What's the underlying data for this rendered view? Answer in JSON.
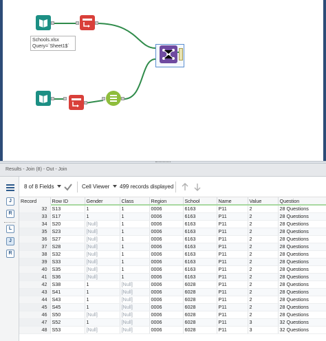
{
  "annotation": {
    "line1": "Schools.xlsx",
    "line2": "Query=`Sheet1$`"
  },
  "results": {
    "title": "Results - Join (8) - Out - Join",
    "fields_label": "8 of 8 Fields",
    "viewer_label": "Cell Viewer",
    "records_label": "499 records displayed"
  },
  "rail": [
    "L",
    "J",
    "R"
  ],
  "rail_top": [
    "J",
    "R"
  ],
  "columns": [
    "Record",
    "Row ID",
    "Gender",
    "Class",
    "Region",
    "School",
    "Name",
    "Value",
    "Question"
  ],
  "rows": [
    [
      "32",
      "S13",
      "1",
      "1",
      "0006",
      "6163",
      "P11",
      "2",
      "28 Questions"
    ],
    [
      "33",
      "S17",
      "1",
      "1",
      "0006",
      "6163",
      "P11",
      "2",
      "28 Questions"
    ],
    [
      "34",
      "S20",
      "[Null]",
      "1",
      "0006",
      "6163",
      "P11",
      "2",
      "28 Questions"
    ],
    [
      "35",
      "S23",
      "[Null]",
      "1",
      "0006",
      "6163",
      "P11",
      "2",
      "28 Questions"
    ],
    [
      "36",
      "S27",
      "[Null]",
      "1",
      "0006",
      "6163",
      "P11",
      "2",
      "28 Questions"
    ],
    [
      "37",
      "S28",
      "[Null]",
      "1",
      "0006",
      "6163",
      "P11",
      "2",
      "28 Questions"
    ],
    [
      "38",
      "S32",
      "[Null]",
      "1",
      "0006",
      "6163",
      "P11",
      "2",
      "28 Questions"
    ],
    [
      "39",
      "S33",
      "[Null]",
      "1",
      "0006",
      "6163",
      "P11",
      "2",
      "28 Questions"
    ],
    [
      "40",
      "S35",
      "[Null]",
      "1",
      "0006",
      "6163",
      "P11",
      "2",
      "28 Questions"
    ],
    [
      "41",
      "S36",
      "[Null]",
      "1",
      "0006",
      "6163",
      "P11",
      "2",
      "28 Questions"
    ],
    [
      "42",
      "S38",
      "1",
      "[Null]",
      "0006",
      "6028",
      "P11",
      "2",
      "28 Questions"
    ],
    [
      "43",
      "S41",
      "1",
      "[Null]",
      "0006",
      "6028",
      "P11",
      "2",
      "28 Questions"
    ],
    [
      "44",
      "S43",
      "1",
      "[Null]",
      "0006",
      "6028",
      "P11",
      "2",
      "28 Questions"
    ],
    [
      "45",
      "S45",
      "1",
      "[Null]",
      "0006",
      "6028",
      "P11",
      "2",
      "28 Questions"
    ],
    [
      "46",
      "S50",
      "[Null]",
      "[Null]",
      "0006",
      "6028",
      "P11",
      "2",
      "28 Questions"
    ],
    [
      "47",
      "S52",
      "1",
      "[Null]",
      "0006",
      "6028",
      "P11",
      "3",
      "32 Questions"
    ],
    [
      "48",
      "S53",
      "[Null]",
      "[Null]",
      "0006",
      "6028",
      "P11",
      "3",
      "32 Questions"
    ]
  ]
}
